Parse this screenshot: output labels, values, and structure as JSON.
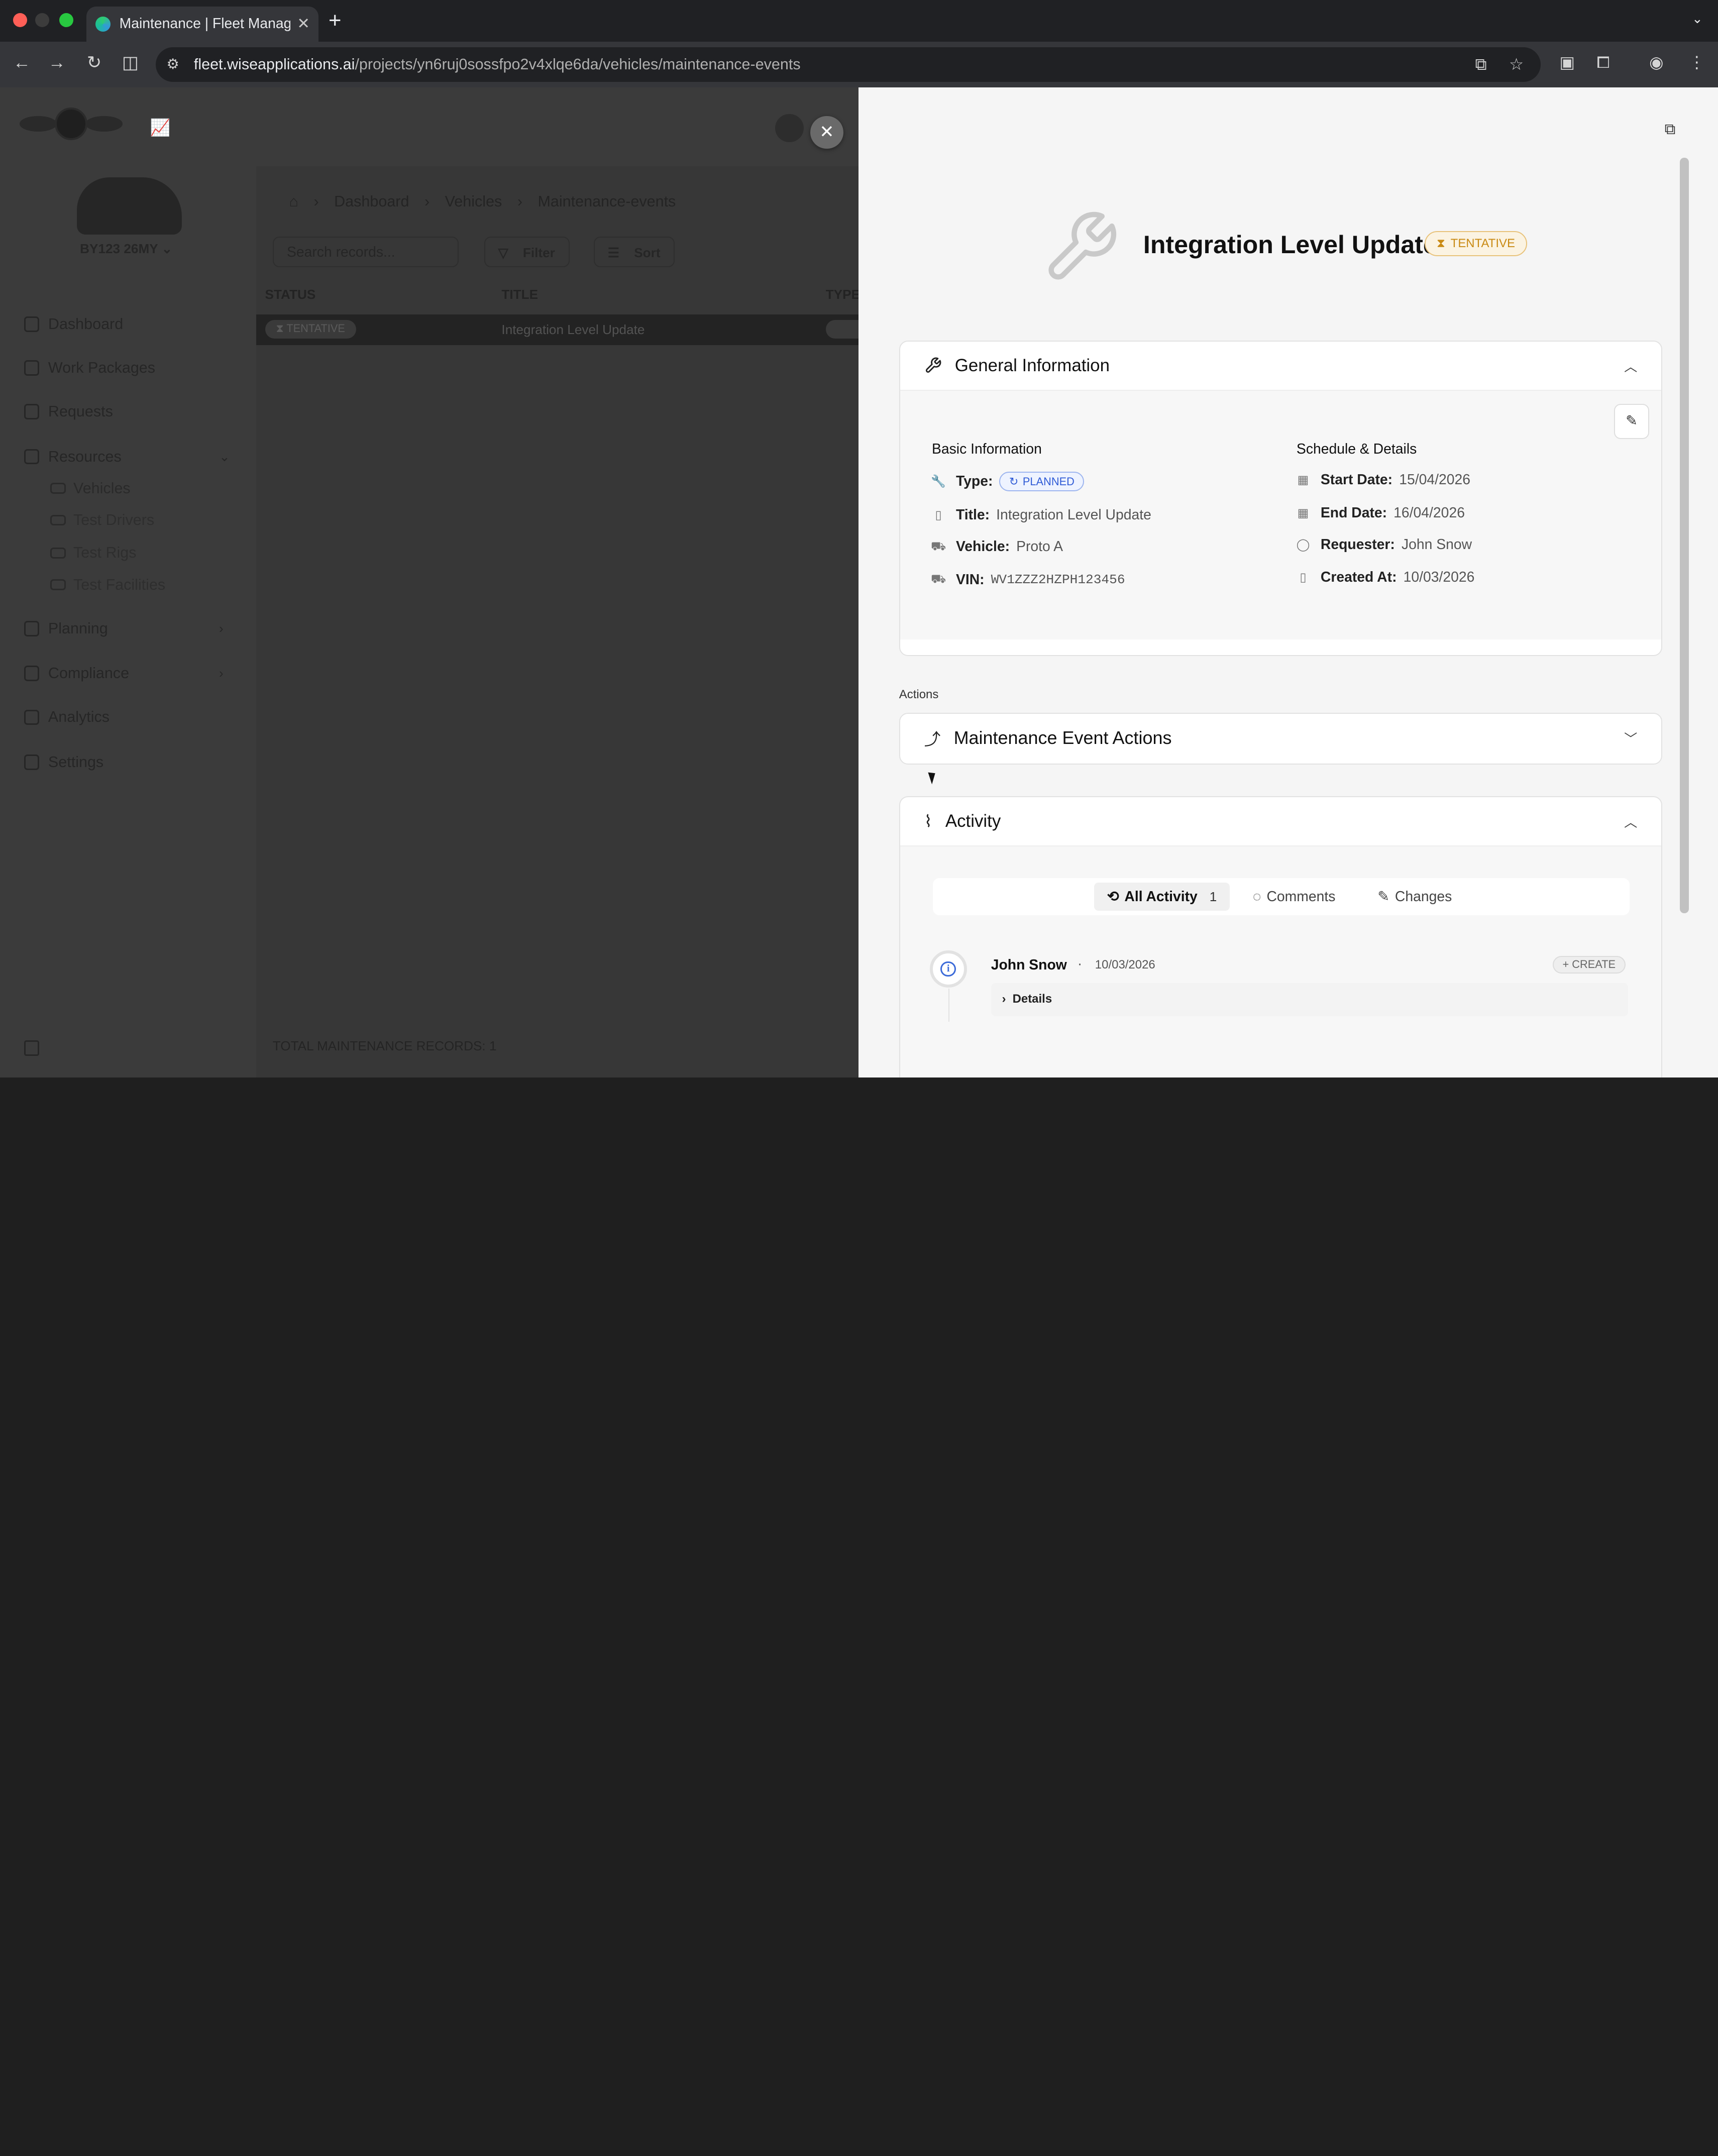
{
  "browser": {
    "tab_title": "Maintenance | Fleet Managem",
    "url_host": "fleet.wiseapplications.ai",
    "url_path": "/projects/yn6ruj0sossfpo2v4xlqe6da/vehicles/maintenance-events"
  },
  "app": {
    "vehicle_label": "BY123 26MY",
    "nav": {
      "dashboard": "Dashboard",
      "work_packages": "Work Packages",
      "requests": "Requests",
      "resources": "Resources",
      "vehicles": "Vehicles",
      "test_drivers": "Test Drivers",
      "test_rigs": "Test Rigs",
      "test_facilities": "Test Facilities",
      "planning": "Planning",
      "compliance": "Compliance",
      "analytics": "Analytics",
      "settings": "Settings"
    },
    "breadcrumb": [
      "Dashboard",
      "Vehicles",
      "Maintenance-events"
    ],
    "search_placeholder": "Search records...",
    "filter_label": "Filter",
    "sort_label": "Sort",
    "table": {
      "headers": [
        "STATUS",
        "TITLE",
        "TYPE"
      ],
      "rows": [
        {
          "status": "TENTATIVE",
          "title": "Integration Level Update"
        }
      ]
    },
    "total_records": "TOTAL MAINTENANCE RECORDS: 1"
  },
  "drawer": {
    "title": "Integration Level Update",
    "status": "TENTATIVE",
    "general": {
      "header": "General Information",
      "basic_label": "Basic Information",
      "schedule_label": "Schedule & Details",
      "type_key": "Type:",
      "type_value": "PLANNED",
      "title_key": "Title:",
      "title_value": "Integration Level Update",
      "vehicle_key": "Vehicle:",
      "vehicle_value": "Proto A",
      "vin_key": "VIN:",
      "vin_value": "WV1ZZZ2HZPH123456",
      "start_key": "Start Date:",
      "start_value": "15/04/2026",
      "end_key": "End Date:",
      "end_value": "16/04/2026",
      "requester_key": "Requester:",
      "requester_value": "John Snow",
      "created_key": "Created At:",
      "created_value": "10/03/2026"
    },
    "actions_label": "Actions",
    "actions_header": "Maintenance Event Actions",
    "activity": {
      "header": "Activity",
      "tabs": {
        "all": "All Activity",
        "all_count": "1",
        "comments": "Comments",
        "changes": "Changes"
      },
      "entry": {
        "user": "John Snow",
        "date": "10/03/2026",
        "action": "CREATE",
        "details": "Details"
      }
    }
  },
  "colors": {
    "tentative": "#c98a14",
    "planned": "#2f5bd6",
    "drawer_bg": "#f5f5f5",
    "overlay": "#3a3a3a"
  }
}
